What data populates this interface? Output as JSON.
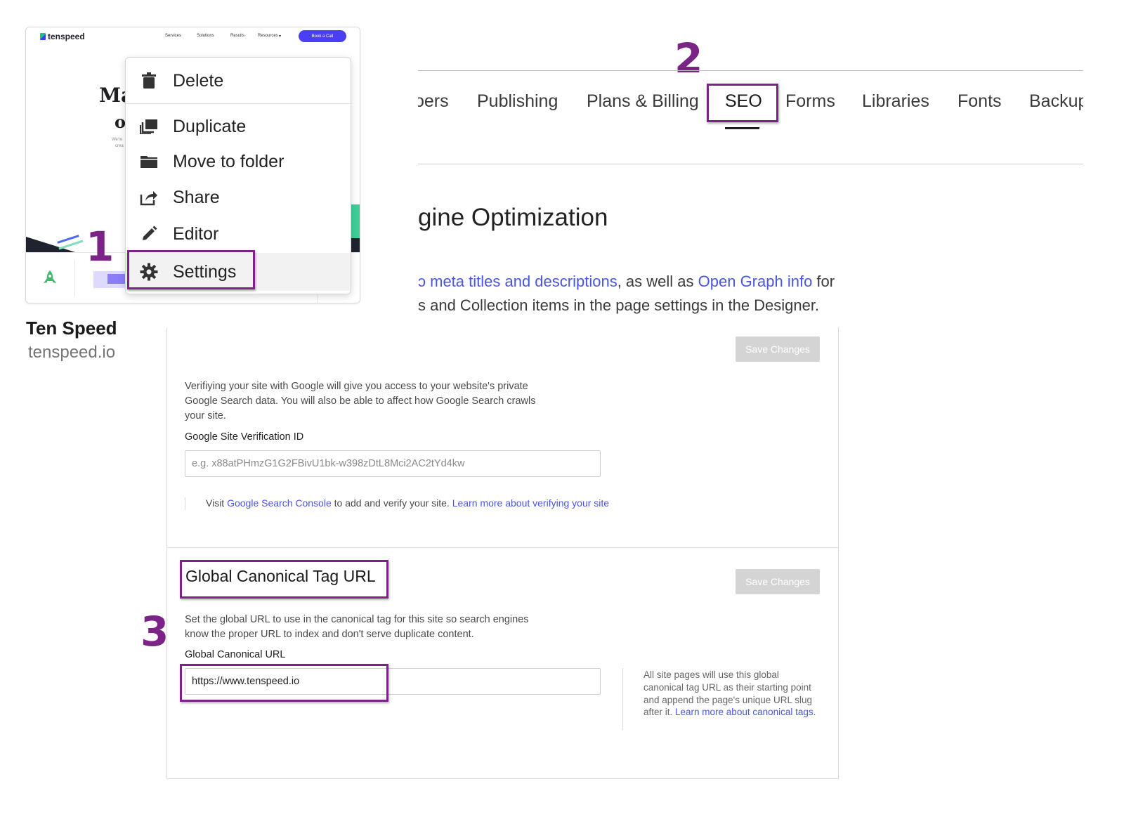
{
  "site_card": {
    "thumbnail": {
      "logo": "tenspeed",
      "nav": [
        "Services",
        "Solutions",
        "Results",
        "Resources"
      ],
      "cta": "Book a Call",
      "hero_fragments": [
        "Ma",
        "o"
      ],
      "hero_small": [
        "We're",
        "crea"
      ]
    },
    "name": "Ten Speed",
    "domain": "tenspeed.io"
  },
  "context_menu": {
    "items": [
      {
        "label": "Delete",
        "icon": "trash-icon"
      },
      {
        "label": "Duplicate",
        "icon": "duplicate-icon"
      },
      {
        "label": "Move to folder",
        "icon": "folder-icon"
      },
      {
        "label": "Share",
        "icon": "share-icon"
      },
      {
        "label": "Editor",
        "icon": "pencil-icon"
      },
      {
        "label": "Settings",
        "icon": "gear-icon"
      }
    ],
    "selected": "Settings"
  },
  "steps": [
    "1",
    "2",
    "3"
  ],
  "tabs": {
    "items": [
      "oers",
      "Publishing",
      "Plans & Billing",
      "SEO",
      "Forms",
      "Libraries",
      "Fonts",
      "Backup"
    ],
    "active": "SEO"
  },
  "seo_section": {
    "title": "gine Optimization",
    "desc_line1_prefix": "ↄ meta titles and descriptions",
    "desc_line1_mid": ", as well as ",
    "desc_line1_link": "Open Graph info",
    "desc_line1_suffix": " for",
    "desc_line2": "s and Collection items in the page settings in the Designer."
  },
  "google_verification": {
    "save_label": "Save Changes",
    "description": [
      "Verifiying your site with Google will give you access to your website's private",
      "Google Search data. You will also be able to affect how Google Search crawls",
      "your site."
    ],
    "field_label": "Google Site Verification ID",
    "placeholder": "e.g. x88atPHmzG1G2FBivU1bk-w398zDtL8Mci2AC2tYd4kw",
    "help_prefix": "Visit ",
    "help_link1": "Google Search Console",
    "help_mid": " to add and verify your site. ",
    "help_link2": "Learn more about verifying your site"
  },
  "canonical": {
    "title": "Global Canonical Tag URL",
    "save_label": "Save Changes",
    "description": [
      "Set the global URL to use in the canonical tag for this site so search engines",
      "know the proper URL to index and don't serve duplicate content."
    ],
    "field_label": "Global Canonical URL",
    "value": "https://www.tenspeed.io",
    "note_text": "All site pages will use this global canonical tag URL as their starting point and append the page's unique URL slug after it. ",
    "note_link": "Learn more about canonical tags",
    "note_end": "."
  },
  "colors": {
    "highlight": "#7b2387",
    "link": "#4a55e0",
    "cta": "#4b3ff5",
    "button_disabled": "#d4d4d4"
  }
}
